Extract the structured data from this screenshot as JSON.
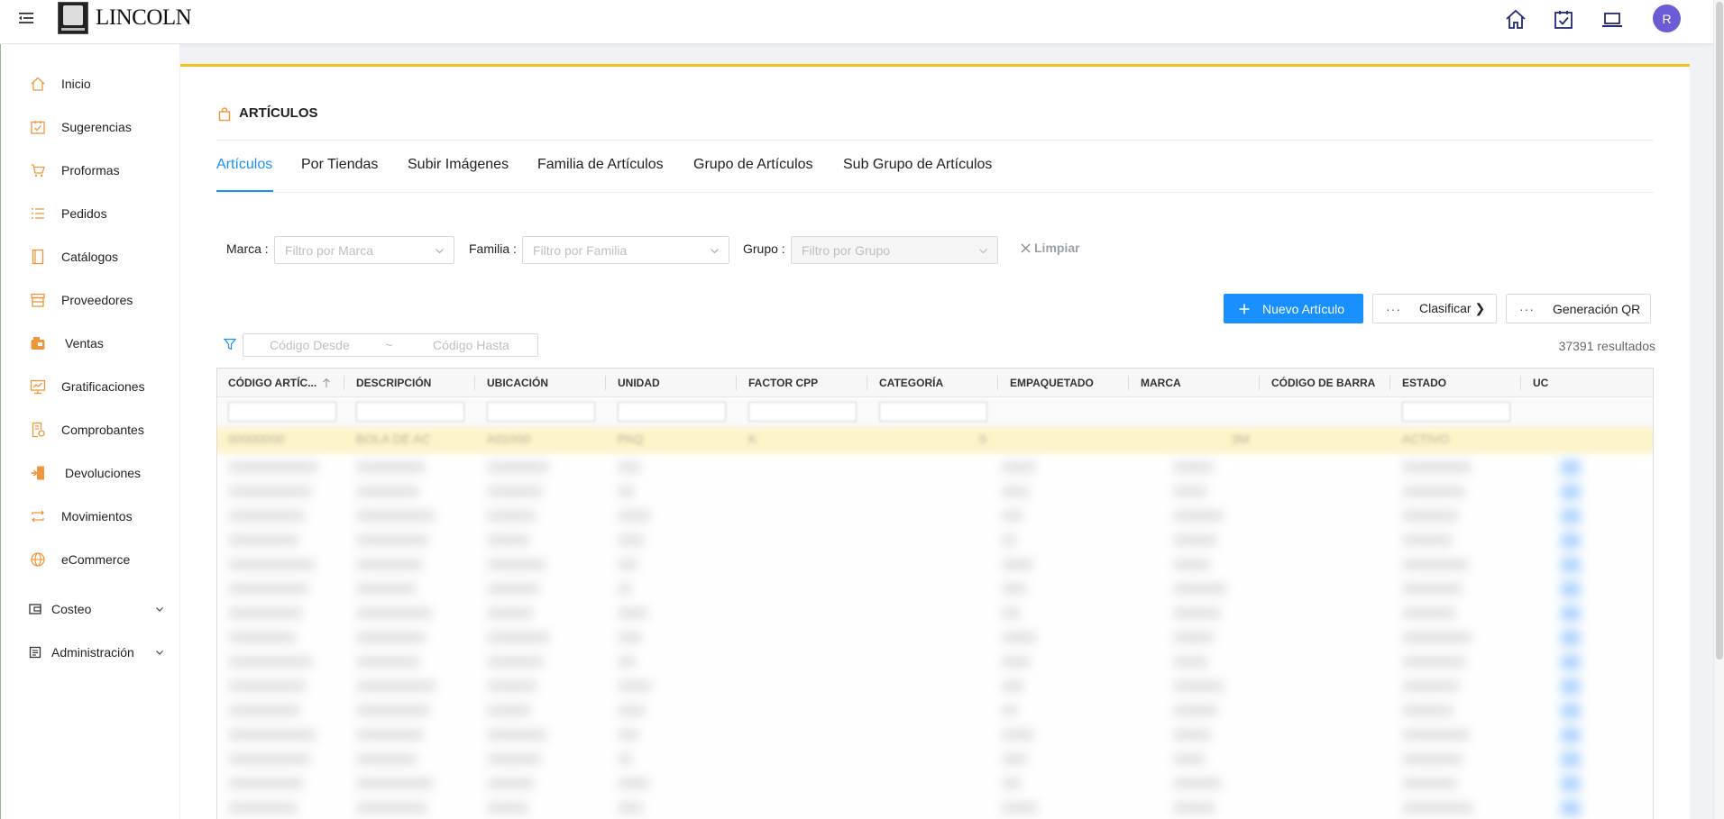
{
  "header": {
    "logo_text": "LINCOLN",
    "avatar_letter": "R",
    "icons": [
      "home-icon",
      "calendar-check-icon",
      "laptop-icon"
    ],
    "accent_color": "#1890ff"
  },
  "sidebar": {
    "items": [
      {
        "label": "Inicio",
        "icon": "home-icon"
      },
      {
        "label": "Sugerencias",
        "icon": "calendar-check-icon"
      },
      {
        "label": "Proformas",
        "icon": "cart-icon"
      },
      {
        "label": "Pedidos",
        "icon": "list-icon"
      },
      {
        "label": "Catálogos",
        "icon": "book-icon"
      },
      {
        "label": "Proveedores",
        "icon": "store-icon"
      },
      {
        "label": "Ventas",
        "icon": "cash-register-icon"
      },
      {
        "label": "Gratificaciones",
        "icon": "chart-board-icon"
      },
      {
        "label": "Comprobantes",
        "icon": "receipt-icon"
      },
      {
        "label": "Devoluciones",
        "icon": "return-door-icon"
      },
      {
        "label": "Movimientos",
        "icon": "swap-icon"
      },
      {
        "label": "eCommerce",
        "icon": "globe-icon"
      }
    ],
    "groups": [
      {
        "label": "Costeo",
        "icon": "wallet-icon"
      },
      {
        "label": "Administración",
        "icon": "admin-doc-icon"
      }
    ],
    "icon_color": "#f0963a"
  },
  "page": {
    "title": "ARTÍCULOS",
    "tabs": [
      {
        "label": "Artículos",
        "active": true
      },
      {
        "label": "Por Tiendas"
      },
      {
        "label": "Subir Imágenes"
      },
      {
        "label": "Familia de Artículos"
      },
      {
        "label": "Grupo de Artículos"
      },
      {
        "label": "Sub Grupo de Artículos"
      }
    ]
  },
  "filters": {
    "marca_label": "Marca :",
    "marca_placeholder": "Filtro por Marca",
    "familia_label": "Familia :",
    "familia_placeholder": "Filtro por Familia",
    "grupo_label": "Grupo :",
    "grupo_placeholder": "Filtro por Grupo",
    "clear_label": "Limpiar"
  },
  "actions": {
    "new_label": "Nuevo Artículo",
    "classify_label": "Clasificar ❯",
    "qr_label": "Generación QR"
  },
  "code_range": {
    "from_placeholder": "Código Desde",
    "separator": "~",
    "to_placeholder": "Código Hasta"
  },
  "results_text": "37391 resultados",
  "table": {
    "columns": [
      "CÓDIGO ARTÍC...",
      "DESCRIPCIÓN",
      "UBICACIÓN",
      "UNIDAD",
      "FACTOR CPP",
      "CATEGORÍA",
      "EMPAQUETADO",
      "MARCA",
      "CÓDIGO DE BARRA",
      "ESTADO",
      "UC"
    ],
    "highlight_row": {
      "codigo": "00000000",
      "descripcion": "BOLA DE AC",
      "ubicacion": "A01000",
      "unidad": "PAQ",
      "factor": "K",
      "categoria": "0",
      "marca": "3M",
      "estado": "ACTIVO"
    }
  }
}
